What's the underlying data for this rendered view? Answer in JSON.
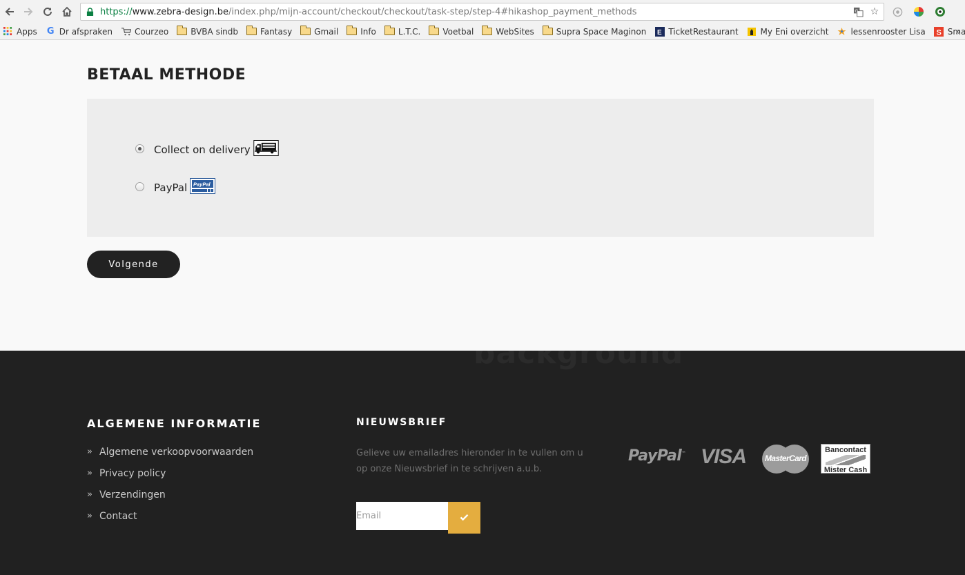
{
  "browser": {
    "url_protocol": "https://",
    "url_host": "www.zebra-design.be",
    "url_path": "/index.php/mijn-account/checkout/checkout/task-step/step-4#hikashop_payment_methods"
  },
  "bookmarks": [
    {
      "label": "Apps",
      "icon": "apps-grid-icon"
    },
    {
      "label": "Dr afspraken",
      "icon": "google-g-icon"
    },
    {
      "label": "Courzeo",
      "icon": "cart-icon"
    },
    {
      "label": "BVBA sindb",
      "icon": "folder-icon"
    },
    {
      "label": "Fantasy",
      "icon": "folder-icon"
    },
    {
      "label": "Gmail",
      "icon": "folder-icon"
    },
    {
      "label": "Info",
      "icon": "folder-icon"
    },
    {
      "label": "L.T.C.",
      "icon": "folder-icon"
    },
    {
      "label": "Voetbal",
      "icon": "folder-icon"
    },
    {
      "label": "WebSites",
      "icon": "folder-icon"
    },
    {
      "label": "Supra Space Maginon",
      "icon": "folder-icon"
    },
    {
      "label": "TicketRestaurant",
      "icon": "ticket-restaurant-icon"
    },
    {
      "label": "My Eni overzicht",
      "icon": "eni-icon"
    },
    {
      "label": "lessenrooster Lisa",
      "icon": "star-figure-icon"
    },
    {
      "label": "Smartschool",
      "icon": "smartschool-icon"
    }
  ],
  "page": {
    "title": "BETAAL METHODE",
    "payment_methods": [
      {
        "label": "Collect on delivery",
        "selected": true,
        "icon": "delivery-truck-icon"
      },
      {
        "label": "PayPal",
        "selected": false,
        "icon": "paypal-icon"
      }
    ],
    "next_button": "Volgende"
  },
  "footer": {
    "background_text": "background",
    "info_heading": "ALGEMENE INFORMATIE",
    "info_links": [
      "Algemene verkoopvoorwaarden",
      "Privacy policy",
      "Verzendingen",
      "Contact"
    ],
    "newsletter_heading": "NIEUWSBRIEF",
    "newsletter_text": "Gelieve uw emailadres hieronder in te vullen om u op onze Nieuwsbrief in te schrijven a.u.b.",
    "email_placeholder": "Email",
    "payment_logos": {
      "paypal": "PayPal",
      "visa": "VISA",
      "mastercard": "MasterCard",
      "bancontact_top": "Bancontact",
      "bancontact_bottom": "Mister Cash"
    },
    "accent_color": "#e4ad3f"
  }
}
